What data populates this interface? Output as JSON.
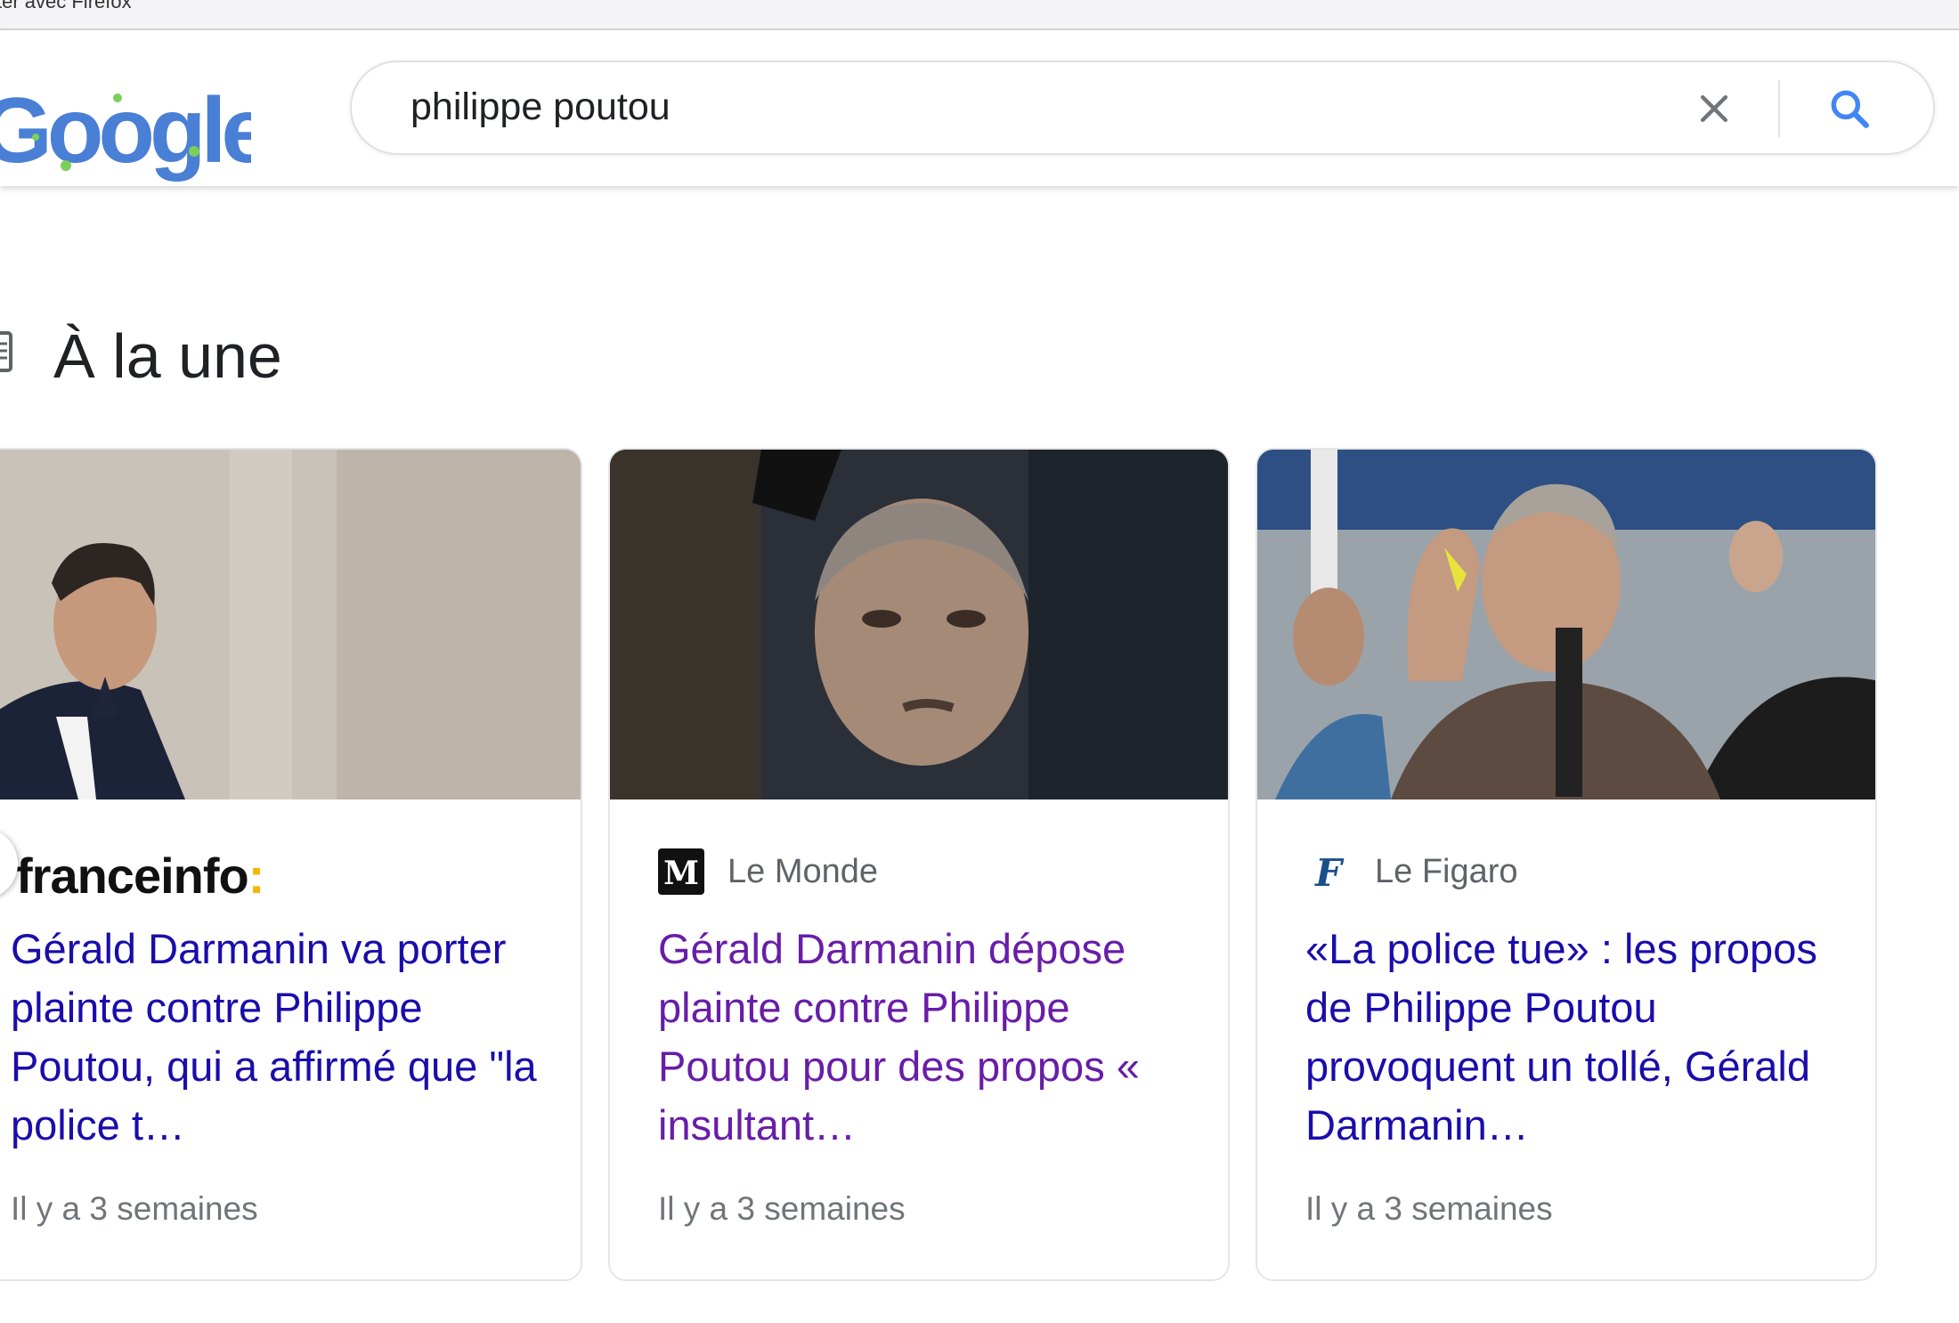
{
  "browser": {
    "banner_text": "ter avec Firefox"
  },
  "search": {
    "logo_text": "Google",
    "query": "philippe poutou"
  },
  "section": {
    "title": "À la une"
  },
  "cards": [
    {
      "source": "franceinfo:",
      "source_main": "franceinfo",
      "source_colon": ":",
      "headline": "Gérald Darmanin va porter plainte contre Philippe Poutou, qui a affirmé que \"la police t…",
      "time": "Il y a 3 semaines",
      "visited": false
    },
    {
      "source": "Le Monde",
      "headline": "Gérald Darmanin dépose plainte contre Philippe Poutou pour des propos « insultant…",
      "time": "Il y a 3 semaines",
      "visited": true
    },
    {
      "source": "Le Figaro",
      "headline": "«La police tue» : les propos de Philippe Poutou provoquent un tollé, Gérald Darmanin…",
      "time": "Il y a 3 semaines",
      "visited": false
    }
  ],
  "colors": {
    "link": "#1a0dab",
    "visited_link": "#681da8",
    "muted": "#70757a",
    "google_blue": "#4285f4",
    "franceinfo_yellow": "#f5b800"
  },
  "icons": {
    "clear": "close-icon",
    "search": "search-icon",
    "news": "newspaper-icon"
  }
}
